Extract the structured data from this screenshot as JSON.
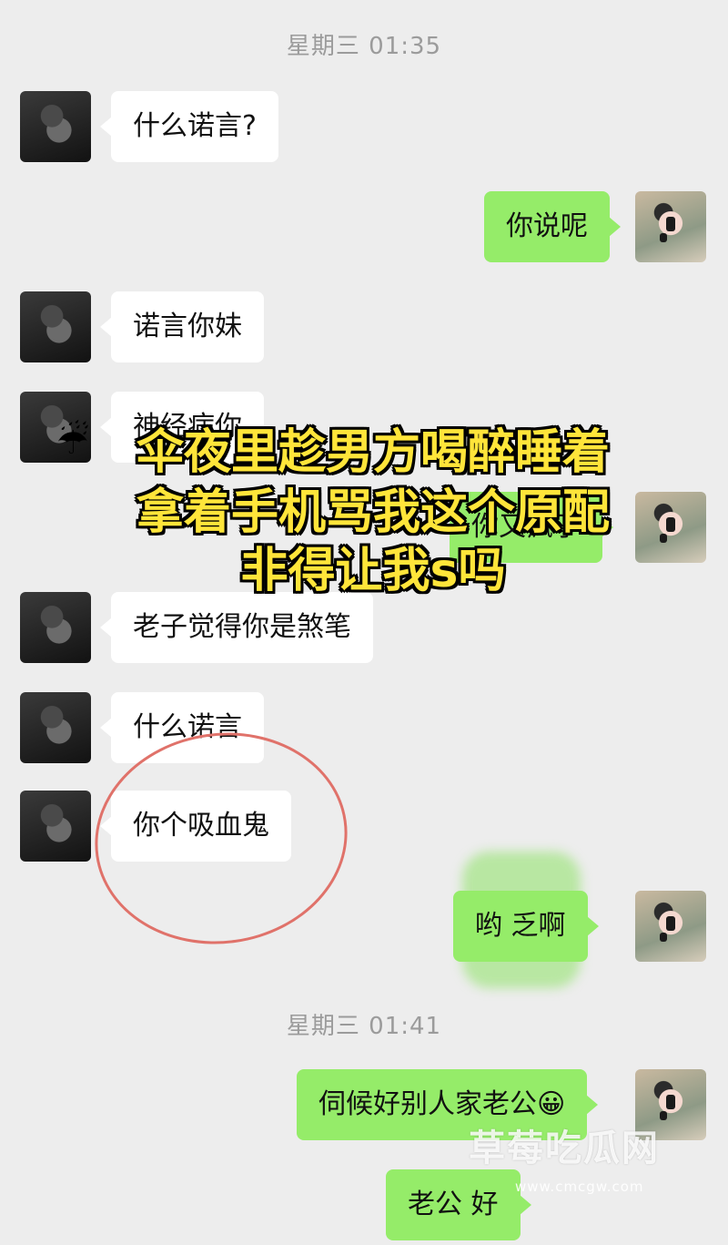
{
  "chat": {
    "timestamp_1": "星期三 01:35",
    "timestamp_2": "星期三 01:41",
    "messages": [
      {
        "from": "him",
        "text": "什么诺言?"
      },
      {
        "from": "her",
        "text": "你说呢"
      },
      {
        "from": "him",
        "text": "诺言你妹"
      },
      {
        "from": "him",
        "text": "神经病你"
      },
      {
        "from": "her",
        "text": "你又疯了"
      },
      {
        "from": "him",
        "text": "老子觉得你是煞笔"
      },
      {
        "from": "him",
        "text": "什么诺言"
      },
      {
        "from": "him",
        "text": "你个吸血鬼"
      },
      {
        "from": "her",
        "text": "哟 乏啊"
      },
      {
        "from": "her",
        "text": "伺候好别人家老公",
        "emoji": "😀"
      },
      {
        "from": "her",
        "text": "老公 好"
      }
    ]
  },
  "overlay": {
    "icon": "umbrella-rain-icon",
    "line1": "伞夜里趁男方喝醉睡着",
    "line2": "拿着手机骂我这个原配",
    "line3": "非得让我s吗"
  },
  "watermark": {
    "title": "草莓吃瓜网",
    "url": "www.cmcgw.com"
  },
  "colors": {
    "background": "#ededed",
    "incoming_bubble": "#ffffff",
    "outgoing_bubble": "#95ec69",
    "overlay_text": "#ffe53a",
    "annotation_circle": "#e0726a"
  }
}
